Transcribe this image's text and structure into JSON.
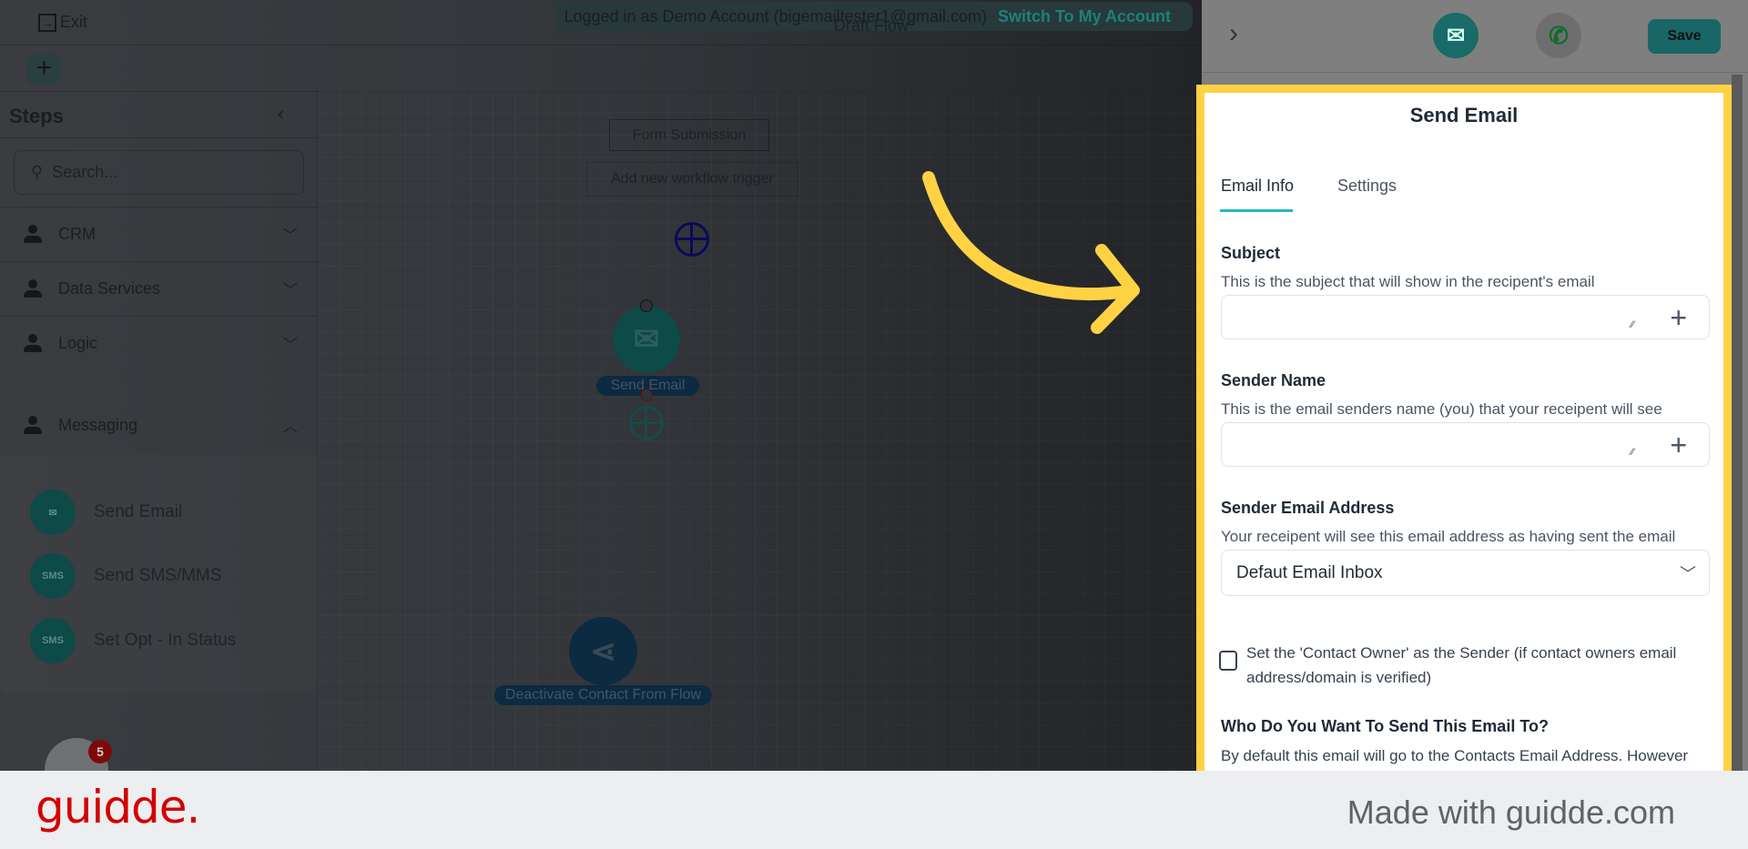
{
  "topbar": {
    "exit_label": "Exit",
    "banner_text": "Logged in as Demo Account (bigemailtester1@gmail.com)",
    "switch_label": "Switch To My Account",
    "flow_title": "Draft Flow"
  },
  "sidebar": {
    "title": "Steps",
    "search_placeholder": "Search...",
    "categories": [
      {
        "label": "CRM"
      },
      {
        "label": "Data Services"
      },
      {
        "label": "Logic"
      },
      {
        "label": "Messaging"
      }
    ],
    "messaging_items": [
      {
        "label": "Send Email",
        "icon": "email-icon"
      },
      {
        "label": "Send SMS/MMS",
        "icon": "sms-icon"
      },
      {
        "label": "Set Opt - In Status",
        "icon": "sms-icon"
      }
    ],
    "notification_count": "5"
  },
  "canvas": {
    "trigger": "Form Submission",
    "add_trigger": "Add new workflow trigger",
    "nodes": [
      {
        "label": "Send Email"
      },
      {
        "label": "Deactivate Contact From Flow"
      }
    ]
  },
  "panel": {
    "save_label": "Save",
    "title": "Send Email",
    "tabs": [
      {
        "label": "Email Info",
        "active": true
      },
      {
        "label": "Settings",
        "active": false
      }
    ],
    "subject": {
      "label": "Subject",
      "help": "This is the subject that will show in the recipent's email",
      "value": ""
    },
    "sender_name": {
      "label": "Sender Name",
      "help": "This is the email senders name (you) that your receipent will see",
      "value": ""
    },
    "sender_email": {
      "label": "Sender Email Address",
      "help": "Your receipent will see this email address as having sent the email",
      "selected": "Defaut Email Inbox"
    },
    "contact_owner": {
      "label": "Set the 'Contact Owner' as the Sender (if contact owners email address/domain is verified)",
      "checked": false
    },
    "recipient": {
      "label": "Who Do You Want To Send This Email To?",
      "help": "By default this email will go to the Contacts Email Address. However"
    }
  },
  "footer": {
    "logo": "guidde.",
    "made_with": "Made with guidde.com"
  },
  "colors": {
    "highlight": "#ffd243",
    "accent": "#22b8c4",
    "brand": "#d40000"
  }
}
